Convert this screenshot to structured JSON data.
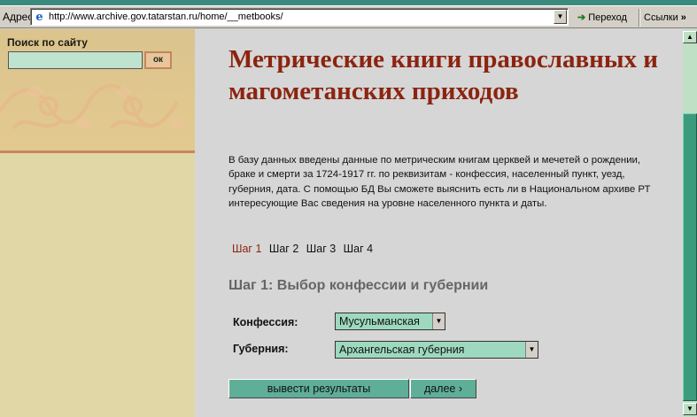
{
  "browser": {
    "address_label": "Адрес",
    "url": "http://www.archive.gov.tatarstan.ru/home/__metbooks/",
    "go_label": "Переход",
    "links_label": "Ссылки",
    "links_chevron": "»",
    "dropdown_glyph": "▼",
    "ie_icon": "e-logo-icon"
  },
  "sidebar": {
    "search_title": "Поиск по сайту",
    "search_value": "",
    "search_button": "ок"
  },
  "main": {
    "title": "Метрические книги православных и магометанских приходов",
    "description": "В базу данных введены данные по метрическим книгам церквей и мечетей о рождении, браке и смерти за 1724-1917 гг. по реквизитам - конфессия, населенный пункт, уезд, губерния, дата. С помощью БД Вы сможете выяснить есть ли в Национальном архиве РТ интересующие Вас сведения на уровне населенного пункта и даты.",
    "steps": [
      "Шаг 1",
      "Шаг 2",
      "Шаг 3",
      "Шаг 4"
    ],
    "active_step": 0,
    "step_heading": "Шаг 1: Выбор конфессии и губернии",
    "form": {
      "confession_label": "Конфессия:",
      "confession_value": "Мусульманская",
      "guberniya_label": "Губерния:",
      "guberniya_value": "Архангельская губерния"
    },
    "buttons": {
      "results": "вывести результаты",
      "next": "далее"
    },
    "next_chevron": "›"
  },
  "scrollbar": {
    "up_glyph": "▲",
    "down_glyph": "▼",
    "position_fraction": 0.2
  },
  "colors": {
    "title_red": "#8b2410",
    "accent_teal": "#5fae97",
    "select_bg": "#9ed9bf",
    "sidebar_tan": "#e1d7a6"
  }
}
